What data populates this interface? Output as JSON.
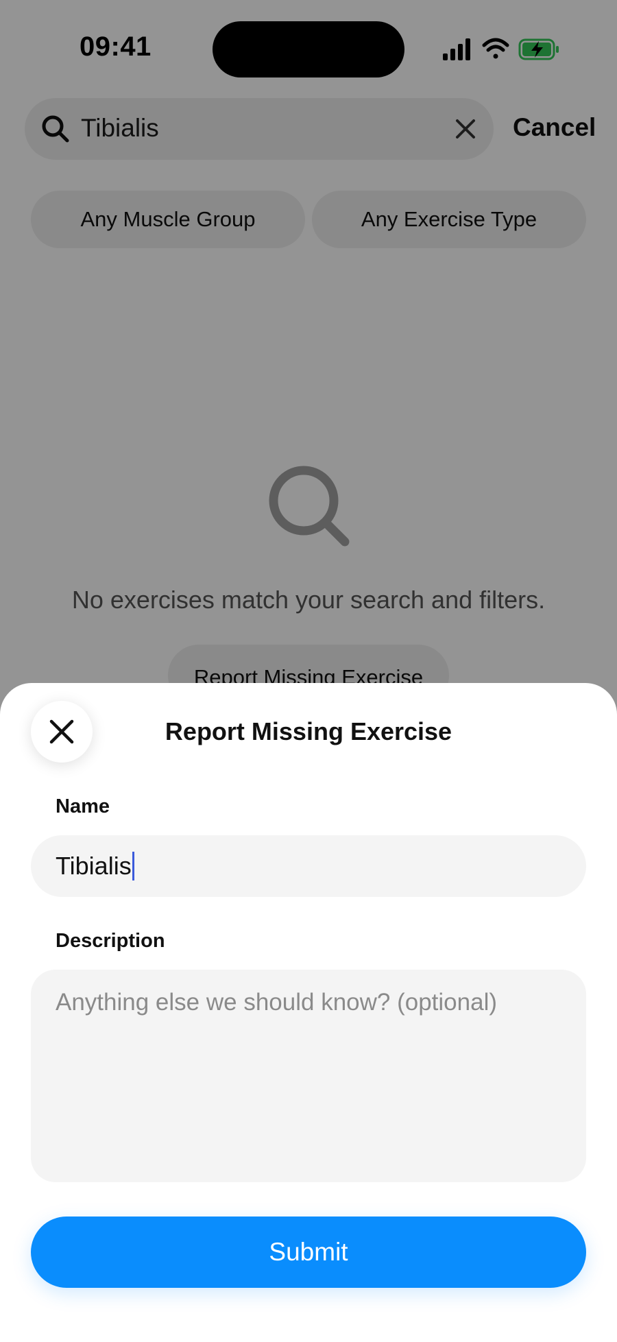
{
  "status_bar": {
    "time": "09:41"
  },
  "search": {
    "query": "Tibialis",
    "cancel_label": "Cancel"
  },
  "filters": {
    "muscle_group": "Any Muscle Group",
    "exercise_type": "Any Exercise Type"
  },
  "empty_state": {
    "message": "No exercises match your search and filters.",
    "report_button_label": "Report Missing Exercise"
  },
  "sheet": {
    "title": "Report Missing Exercise",
    "name_label": "Name",
    "name_value": "Tibialis",
    "description_label": "Description",
    "description_placeholder": "Anything else we should know? (optional)",
    "submit_label": "Submit"
  },
  "colors": {
    "accent": "#0a8dfd",
    "battery_charging": "#34c759",
    "caret": "#3b5bdb"
  },
  "icons": {
    "close": "close-icon",
    "search": "search-icon",
    "clear": "clear-icon",
    "signal": "cellular-signal-icon",
    "wifi": "wifi-icon",
    "battery": "battery-charging-icon"
  }
}
